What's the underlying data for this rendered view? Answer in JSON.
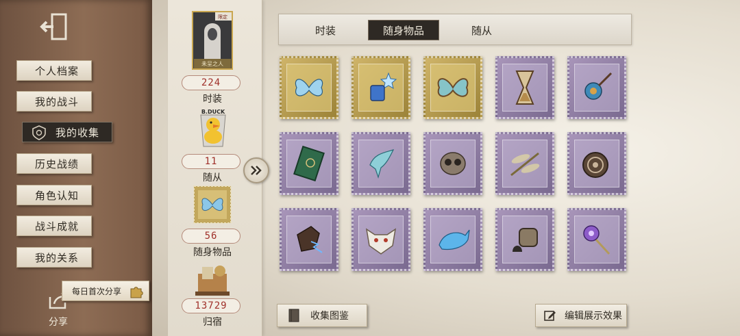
{
  "sidebar": {
    "exit_icon": "exit-door-icon",
    "items": [
      {
        "label": "个人档案",
        "active": false
      },
      {
        "label": "我的战斗",
        "active": false
      },
      {
        "label": "我的收集",
        "active": true,
        "icon": "shield-badge-icon"
      },
      {
        "label": "历史战绩",
        "active": false
      },
      {
        "label": "角色认知",
        "active": false
      },
      {
        "label": "战斗成就",
        "active": false
      },
      {
        "label": "我的关系",
        "active": false
      }
    ],
    "share_label": "分享",
    "share_tag": "每日首次分享"
  },
  "stats": [
    {
      "value": "224",
      "label": "时装",
      "image": "costume-portrait",
      "badge": "限定",
      "caption": "未呈之人"
    },
    {
      "value": "11",
      "label": "随从",
      "image": "duck-pet",
      "caption": "B.DUCK"
    },
    {
      "value": "56",
      "label": "随身物品",
      "image": "butterfly-stamp"
    },
    {
      "value": "13729",
      "label": "归宿",
      "image": "home-decor"
    }
  ],
  "tabs": [
    {
      "label": "时装",
      "active": false
    },
    {
      "label": "随身物品",
      "active": true
    },
    {
      "label": "随从",
      "active": false
    }
  ],
  "items": [
    {
      "name": "blue-butterfly",
      "frame": "gold"
    },
    {
      "name": "star-lantern",
      "frame": "gold"
    },
    {
      "name": "moth-wings",
      "frame": "gold"
    },
    {
      "name": "sand-hourglass",
      "frame": "purple"
    },
    {
      "name": "shell-staff",
      "frame": "purple"
    },
    {
      "name": "green-book",
      "frame": "purple"
    },
    {
      "name": "ice-bird",
      "frame": "purple"
    },
    {
      "name": "owl-cage",
      "frame": "purple"
    },
    {
      "name": "dragonfly",
      "frame": "purple"
    },
    {
      "name": "spiral-shield",
      "frame": "purple"
    },
    {
      "name": "lightning-glove",
      "frame": "purple"
    },
    {
      "name": "fox-mask",
      "frame": "purple"
    },
    {
      "name": "whale-wand",
      "frame": "purple"
    },
    {
      "name": "bell-cage",
      "frame": "purple"
    },
    {
      "name": "amethyst-mace",
      "frame": "purple"
    }
  ],
  "buttons": {
    "collection_guide": "收集图鉴",
    "edit_display": "编辑展示效果"
  },
  "colors": {
    "accent_red": "#a0302a",
    "active_dark": "#2e2924",
    "gold_frame": "#cfb469",
    "purple_frame": "#a895b9"
  }
}
